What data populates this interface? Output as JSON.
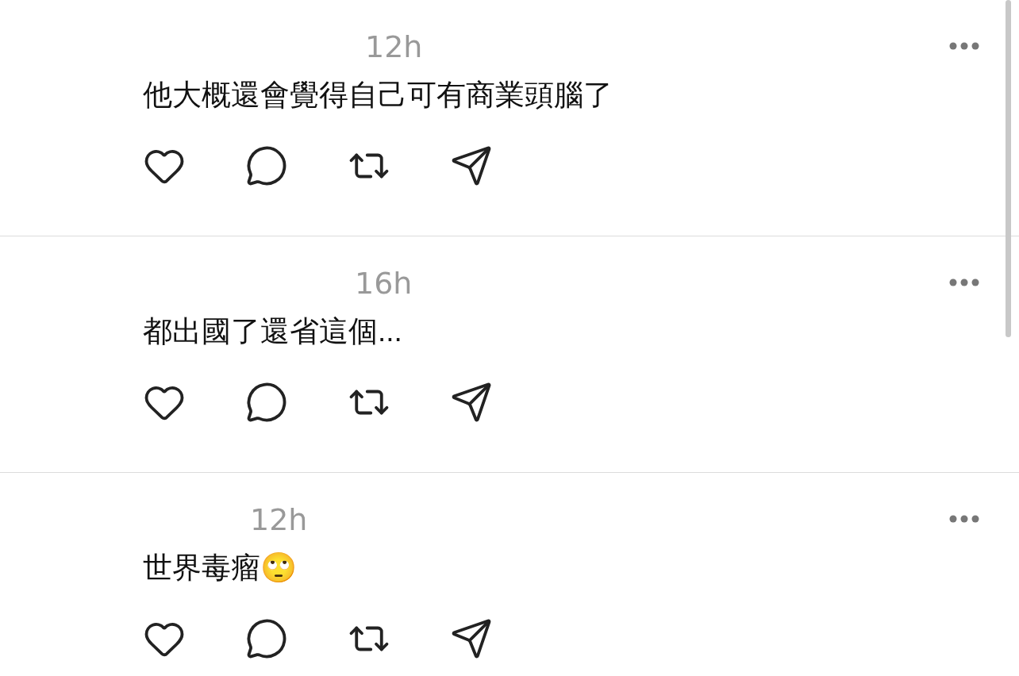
{
  "comments": [
    {
      "time": "12h",
      "text": "他大概還會覺得自己可有商業頭腦了"
    },
    {
      "time": "16h",
      "text": "都出國了還省這個..."
    },
    {
      "time": "12h",
      "text": "世界毒瘤🙄"
    }
  ]
}
